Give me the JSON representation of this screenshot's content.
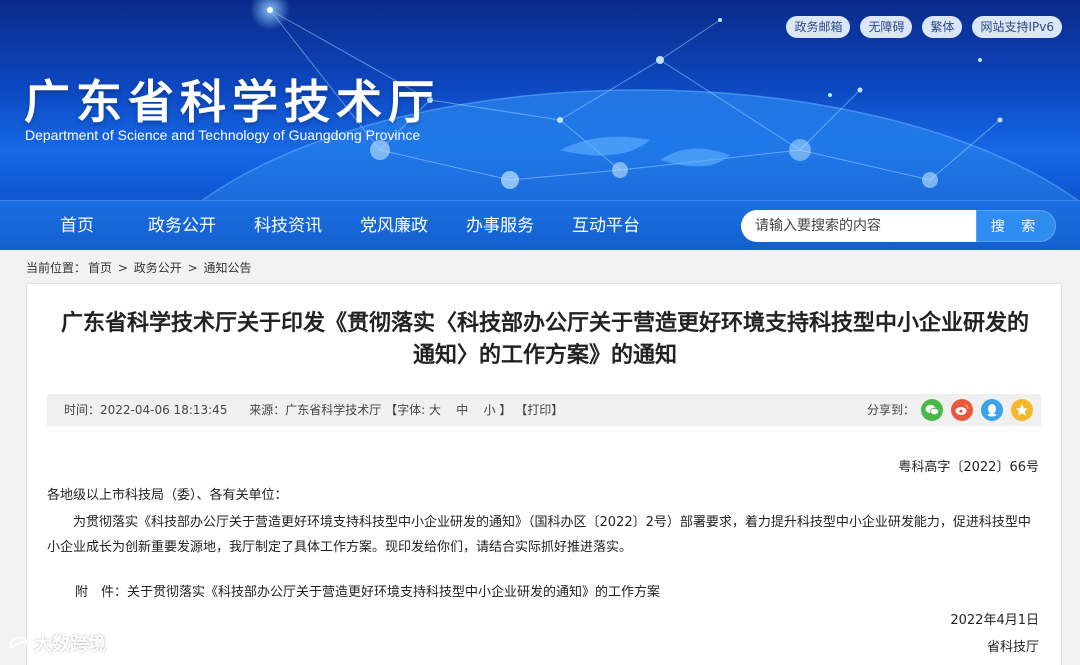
{
  "header": {
    "top_links": [
      "政务邮箱",
      "无障碍",
      "繁体",
      "网站支持IPv6"
    ],
    "site_title": "广东省科学技术厅",
    "site_subtitle": "Department of Science and Technology of Guangdong Province"
  },
  "nav": {
    "items": [
      "首页",
      "政务公开",
      "科技资讯",
      "党风廉政",
      "办事服务",
      "互动平台"
    ],
    "search_placeholder": "请输入要搜索的内容",
    "search_button": "搜 索"
  },
  "breadcrumb": {
    "prefix": "当前位置：",
    "items": [
      "首页",
      "政务公开",
      "通知公告"
    ],
    "separator": ">"
  },
  "article": {
    "title_line1": "广东省科学技术厅关于印发《贯彻落实〈科技部办公厅关于营造更好环境支持科技型中小企业研发的",
    "title_line2": "通知〉的工作方案》的通知",
    "meta": {
      "time": "时间：2022-04-06 18:13:45",
      "source": "来源：广东省科学技术厅",
      "font_label": "【字体:",
      "font_large": "大",
      "font_medium": "中",
      "font_small": "小",
      "font_close": "】",
      "print": "【打印】",
      "share_label": "分享到："
    },
    "doc_number": "粤科高字〔2022〕66号",
    "addressee": "各地级以上市科技局（委）、各有关单位：",
    "body": "为贯彻落实《科技部办公厅关于营造更好环境支持科技型中小企业研发的通知》（国科办区〔2022〕2号）部署要求，着力提升科技型中小企业研发能力，促进科技型中小企业成长为创新重要发源地，我厅制定了具体工作方案。现印发给你们，请结合实际抓好推进落实。",
    "attachment": "附　件：关于贯彻落实《科技部办公厅关于营造更好环境支持科技型中小企业研发的通知》的工作方案",
    "date": "2022年4月1日",
    "signature": "省科技厅"
  },
  "watermark": "大数跨境",
  "colors": {
    "nav_bg": "#145fd0",
    "search_btn": "#2f8cf0",
    "wechat": "#4cb74a",
    "weibo": "#e9573f",
    "qq": "#3ba3e8",
    "qzone": "#f3b82b"
  }
}
